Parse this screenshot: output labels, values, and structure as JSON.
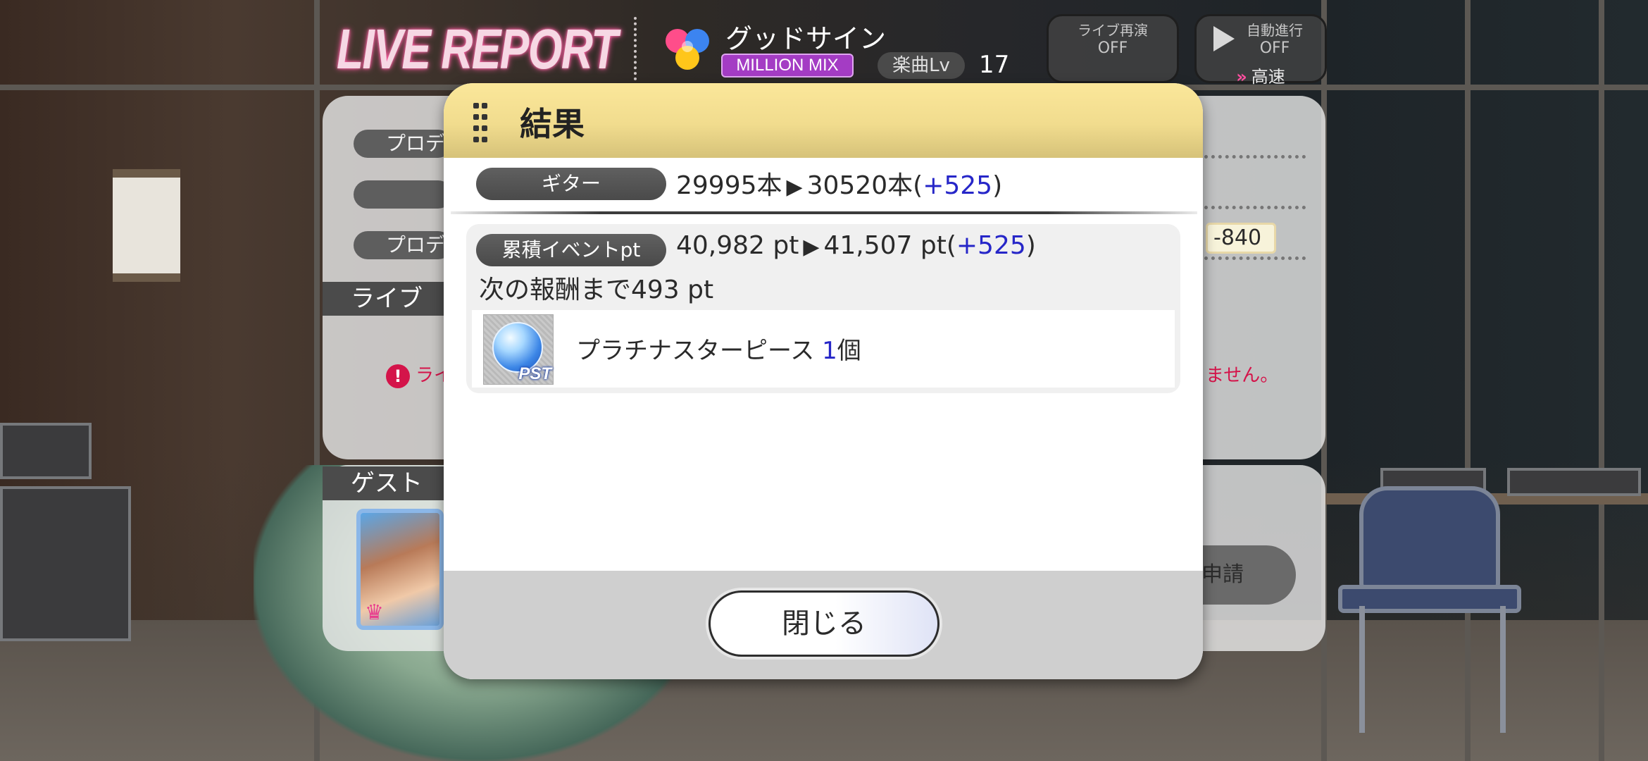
{
  "header": {
    "logo_text": "LIVE REPORT",
    "song_title": "グッドサイン",
    "song_tag": "MILLION MIX",
    "level_label": "楽曲Lv",
    "level_value": "17"
  },
  "controls": {
    "replay": {
      "label": "ライブ再演",
      "state": "OFF"
    },
    "auto": {
      "label": "自動進行",
      "state": "OFF",
      "speed": "高速"
    }
  },
  "background_panel": {
    "row1_label": "プロデ",
    "row3_label": "プロデュ",
    "field_value": "-840",
    "section_live": "ライブ",
    "warning_left": "ライ",
    "warning_right": "ません。",
    "section_guest": "ゲスト",
    "apply_button": "申請"
  },
  "modal": {
    "title": "結果",
    "guitar": {
      "label": "ギター",
      "from": "29995本",
      "to": "30520本",
      "diff": "+525"
    },
    "event_pt": {
      "label": "累積イベントpt",
      "from": "40,982 pt",
      "to": "41,507 pt",
      "diff": "+525"
    },
    "next_reward": "次の報酬まで493 pt",
    "reward": {
      "name": "プラチナスターピース",
      "count": "1",
      "unit": "個",
      "thumb_label": "PST"
    },
    "close_label": "閉じる"
  },
  "colors": {
    "accent_blue": "#2626c8",
    "header_gold": "#f1dc8e",
    "million_purple": "#a43cc4",
    "warning_red": "#d4144a"
  }
}
